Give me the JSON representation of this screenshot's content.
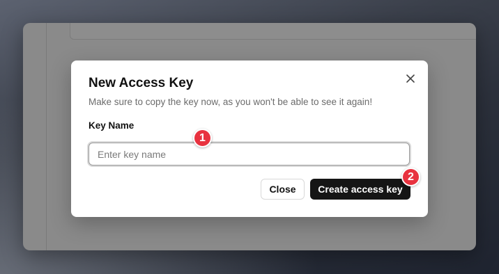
{
  "modal": {
    "title": "New Access Key",
    "subtitle": "Make sure to copy the key now, as you won't be able to see it again!",
    "field_label": "Key Name",
    "input_placeholder": "Enter key name",
    "input_value": "",
    "close_button_label": "Close",
    "create_button_label": "Create access key",
    "close_icon": "close-icon"
  },
  "markers": [
    {
      "label": "1"
    },
    {
      "label": "2"
    }
  ],
  "colors": {
    "primary_button": "#151515",
    "marker": "#e8323f",
    "overlay": "#8a8a8a"
  }
}
